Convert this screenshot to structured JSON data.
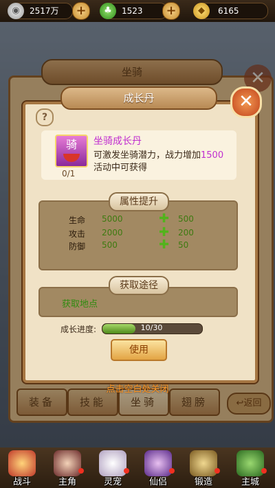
{
  "currencies": [
    {
      "icon": "silver-coin-icon",
      "value": "2517万"
    },
    {
      "icon": "jade-icon",
      "value": "1523"
    },
    {
      "icon": "gold-ingot-icon",
      "value": "6165"
    }
  ],
  "background_window": {
    "title": "坐骑",
    "tabs": [
      "装备",
      "技能",
      "坐骑",
      "翅膀"
    ],
    "back_label": "返回"
  },
  "dialog": {
    "title": "成长丹",
    "help": "?",
    "item": {
      "icon_char": "骑",
      "count": "0/1",
      "name": "坐骑成长丹",
      "desc_prefix": "可激发坐骑潜力，战力增加",
      "desc_value": "1500",
      "desc_line2": "活动中可获得"
    },
    "attributes": {
      "header": "属性提升",
      "rows": [
        {
          "label": "生命",
          "value": "5000",
          "bonus": "500"
        },
        {
          "label": "攻击",
          "value": "2000",
          "bonus": "200"
        },
        {
          "label": "防御",
          "value": "500",
          "bonus": "50"
        }
      ]
    },
    "source": {
      "header": "获取途径",
      "link": "获取地点"
    },
    "progress": {
      "label": "成长进度:",
      "text": "10/30",
      "fraction": 0.3333
    },
    "use_label": "使用"
  },
  "close_hint": "点击空白处关闭",
  "nav": [
    {
      "label": "战斗",
      "icon": "crossed-swords-icon",
      "badge": false
    },
    {
      "label": "主角",
      "icon": "hero-portrait-icon",
      "badge": true
    },
    {
      "label": "灵宠",
      "icon": "fox-pet-icon",
      "badge": true
    },
    {
      "label": "仙侣",
      "icon": "companion-portrait-icon",
      "badge": true
    },
    {
      "label": "锻造",
      "icon": "forge-anvil-icon",
      "badge": true
    },
    {
      "label": "主城",
      "icon": "city-pagoda-icon",
      "badge": true
    }
  ],
  "colors": {
    "accent_purple": "#c02ed0",
    "stat_green": "#3d7a10",
    "hint_orange": "#ff9a2a"
  }
}
